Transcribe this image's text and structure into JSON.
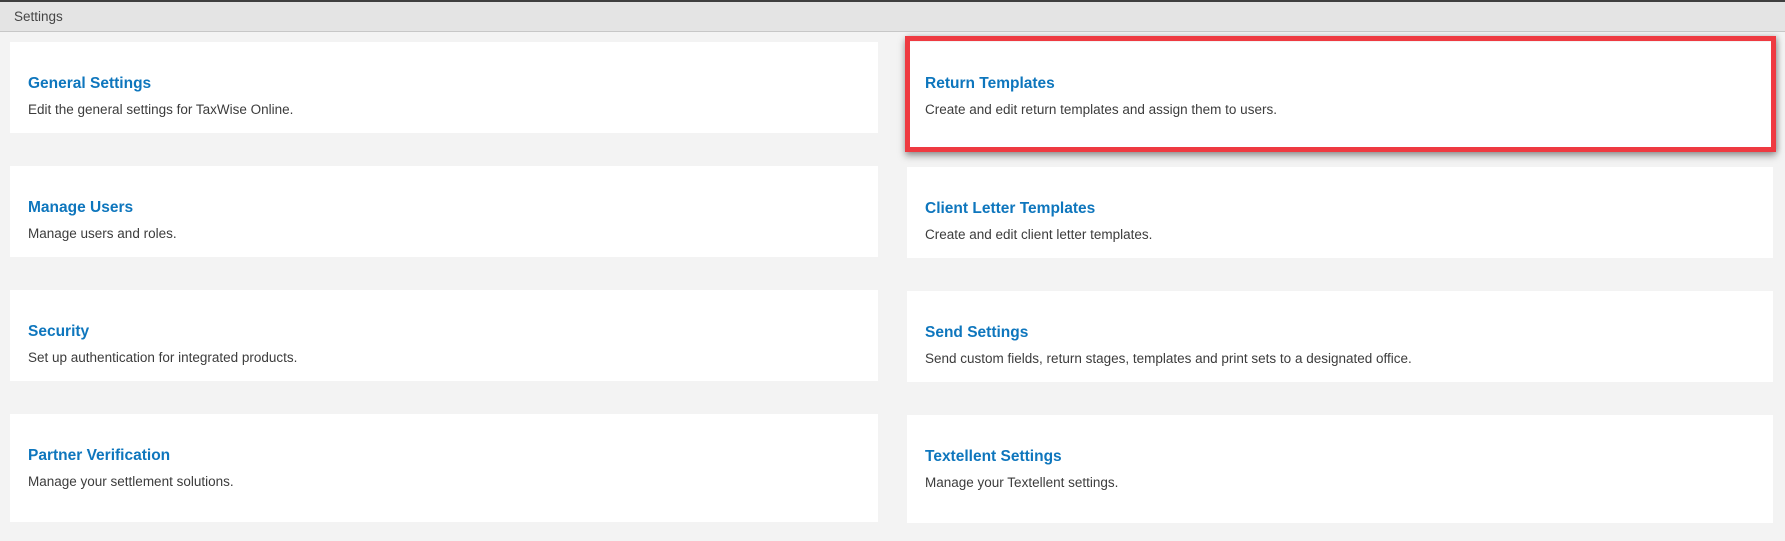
{
  "header": {
    "title": "Settings"
  },
  "colors": {
    "accent_blue": "#0e76bd",
    "highlight_red": "#ee3a41",
    "page_background": "#f3f3f3",
    "header_background": "#e4e4e4"
  },
  "cards": {
    "left": [
      {
        "title": "General Settings",
        "description": "Edit the general settings for TaxWise Online."
      },
      {
        "title": "Manage Users",
        "description": "Manage users and roles."
      },
      {
        "title": "Security",
        "description": "Set up authentication for integrated products."
      },
      {
        "title": "Partner Verification",
        "description": "Manage your settlement solutions."
      }
    ],
    "right": [
      {
        "title": "Return Templates",
        "description": "Create and edit return templates and assign them to users.",
        "highlighted": true
      },
      {
        "title": "Client Letter Templates",
        "description": "Create and edit client letter templates."
      },
      {
        "title": "Send Settings",
        "description": "Send custom fields, return stages, templates and print sets to a designated office."
      },
      {
        "title": "Textellent Settings",
        "description": "Manage your Textellent settings."
      }
    ]
  }
}
